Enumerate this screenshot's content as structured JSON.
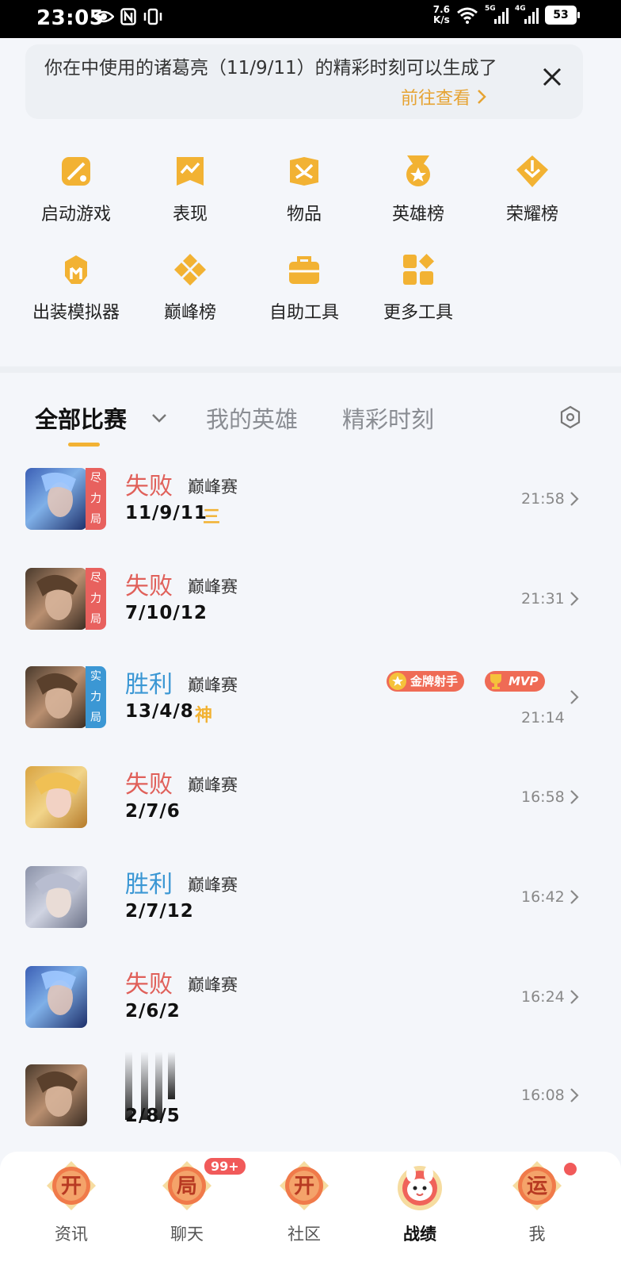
{
  "status_bar": {
    "time": "23:05",
    "net_speed_value": "7.6",
    "net_speed_unit": "K/s",
    "signal1_tag": "5G",
    "signal2_tag": "4G",
    "battery": "53"
  },
  "notice": {
    "text": "你在中使用的诸葛亮（11/9/11）的精彩时刻可以生成了",
    "link": "前往查看",
    "accent_color": "#e6a332"
  },
  "shortcuts": [
    {
      "label": "启动游戏",
      "icon": "launch-game-icon"
    },
    {
      "label": "表现",
      "icon": "performance-icon"
    },
    {
      "label": "物品",
      "icon": "items-icon"
    },
    {
      "label": "英雄榜",
      "icon": "hero-rank-icon"
    },
    {
      "label": "荣耀榜",
      "icon": "glory-rank-icon"
    },
    {
      "label": "出装模拟器",
      "icon": "build-simulator-icon"
    },
    {
      "label": "巅峰榜",
      "icon": "peak-rank-icon"
    },
    {
      "label": "自助工具",
      "icon": "self-service-icon"
    },
    {
      "label": "更多工具",
      "icon": "more-tools-icon"
    }
  ],
  "tabs": [
    {
      "label": "全部比赛",
      "active": true
    },
    {
      "label": "我的英雄",
      "active": false
    },
    {
      "label": "精彩时刻",
      "active": false
    }
  ],
  "matches": [
    {
      "result": "失败",
      "type": "lose",
      "mode": "巅峰赛",
      "kda": "11/9/11",
      "badge": "三",
      "time": "21:58",
      "tag": "尽\n力\n局",
      "tag_color": "#e8615e"
    },
    {
      "result": "失败",
      "type": "lose",
      "mode": "巅峰赛",
      "kda": "7/10/12",
      "badge": "",
      "time": "21:31",
      "tag": "尽\n力\n局",
      "tag_color": "#e8615e"
    },
    {
      "result": "胜利",
      "type": "win",
      "mode": "巅峰赛",
      "kda": "13/4/8",
      "badge": "神",
      "time": "21:14",
      "tag": "实\n力\n局",
      "tag_color": "#3b97d4",
      "medals": [
        "金牌射手",
        "MVP"
      ]
    },
    {
      "result": "失败",
      "type": "lose",
      "mode": "巅峰赛",
      "kda": "2/7/6",
      "badge": "",
      "time": "16:58"
    },
    {
      "result": "胜利",
      "type": "win",
      "mode": "巅峰赛",
      "kda": "2/7/12",
      "badge": "",
      "time": "16:42"
    },
    {
      "result": "失败",
      "type": "lose",
      "mode": "巅峰赛",
      "kda": "2/6/2",
      "badge": "",
      "time": "16:24"
    },
    {
      "result": "",
      "type": "lose",
      "mode": "",
      "kda": "2/8/5",
      "badge": "",
      "time": "16:08"
    }
  ],
  "bottom_nav": [
    {
      "label": "资讯",
      "glyph": "开",
      "active": false
    },
    {
      "label": "聊天",
      "glyph": "局",
      "active": false,
      "badge": "99+"
    },
    {
      "label": "社区",
      "glyph": "开",
      "active": false
    },
    {
      "label": "战绩",
      "glyph": "",
      "active": true
    },
    {
      "label": "我",
      "glyph": "运",
      "active": false,
      "dot": true
    }
  ]
}
